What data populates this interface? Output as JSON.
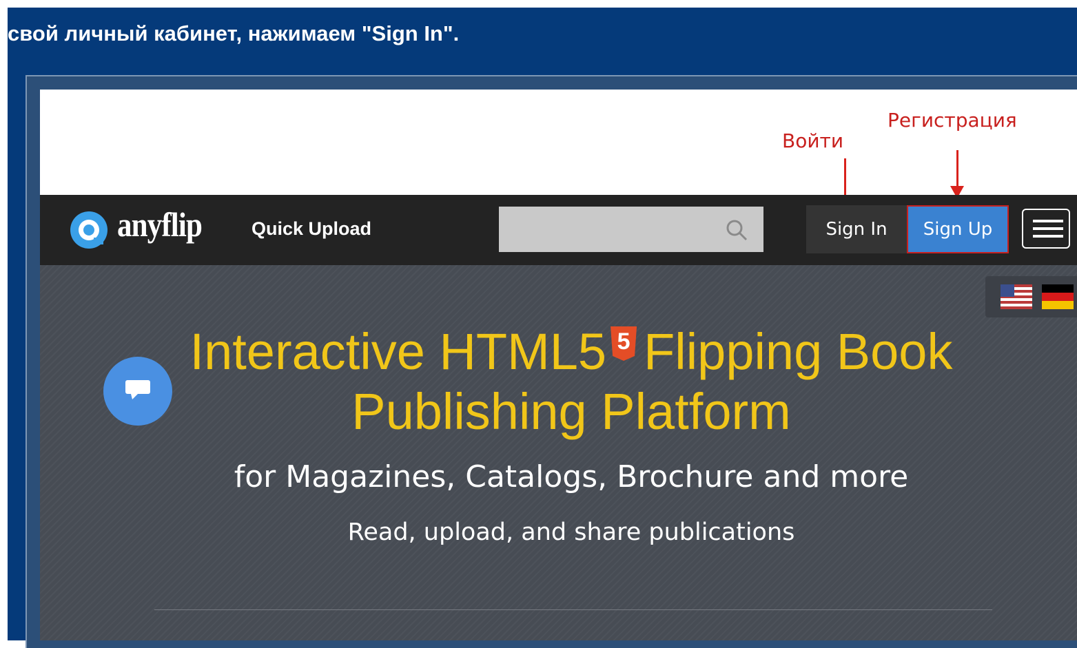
{
  "instruction": "свой личный кабинет, нажимаем \"Sign In\".",
  "annotations": {
    "signin_label": "Войти",
    "signup_label": "Регистрация"
  },
  "navbar": {
    "logo_text": "anyflip",
    "quick_upload": "Quick Upload",
    "search_placeholder": "",
    "sign_in": "Sign In",
    "sign_up": "Sign Up"
  },
  "hero": {
    "title_part1": "Interactive HTML5",
    "html5_badge": "5",
    "title_part2": "Flipping Book",
    "title_line2": "Publishing Platform",
    "subtitle": "for Magazines, Catalogs, Brochure and more",
    "tagline": "Read, upload, and share publications"
  },
  "colors": {
    "page_bg": "#053a7a",
    "annotation_red": "#c8201e",
    "signup_blue": "#3a82d1",
    "title_yellow": "#f1c619",
    "navbar_bg": "#232323"
  },
  "icons": [
    "logo-icon",
    "search-icon",
    "menu-icon",
    "us-flag-icon",
    "de-flag-icon",
    "chat-icon",
    "html5-icon"
  ]
}
